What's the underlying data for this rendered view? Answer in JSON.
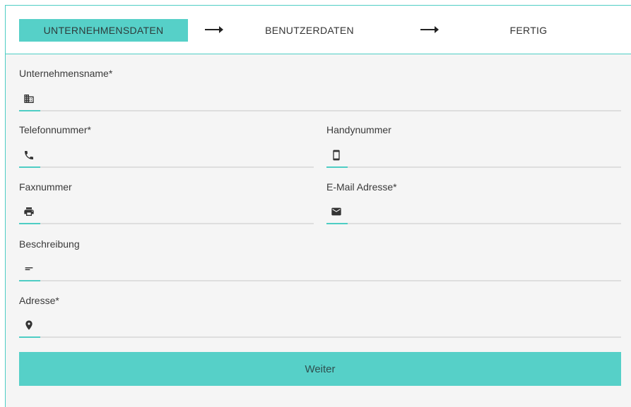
{
  "stepper": {
    "steps": [
      {
        "label": "UNTERNEHMENSDATEN",
        "active": true
      },
      {
        "label": "BENUTZERDATEN",
        "active": false
      },
      {
        "label": "FERTIG",
        "active": false
      }
    ]
  },
  "form": {
    "company_name": {
      "label": "Unternehmensname*",
      "value": "",
      "icon": "building-icon"
    },
    "phone": {
      "label": "Telefonnummer*",
      "value": "",
      "icon": "phone-icon"
    },
    "mobile": {
      "label": "Handynummer",
      "value": "",
      "icon": "smartphone-icon"
    },
    "fax": {
      "label": "Faxnummer",
      "value": "",
      "icon": "printer-icon"
    },
    "email": {
      "label": "E-Mail Adresse*",
      "value": "",
      "icon": "mail-icon"
    },
    "description": {
      "label": "Beschreibung",
      "value": "",
      "icon": "short-text-icon"
    },
    "address": {
      "label": "Adresse*",
      "value": "",
      "icon": "location-pin-icon"
    }
  },
  "submit_label": "Weiter",
  "colors": {
    "accent": "#4ecdc4",
    "button": "#56d0c8",
    "background": "#f5f5f5",
    "underline": "#dedede"
  }
}
